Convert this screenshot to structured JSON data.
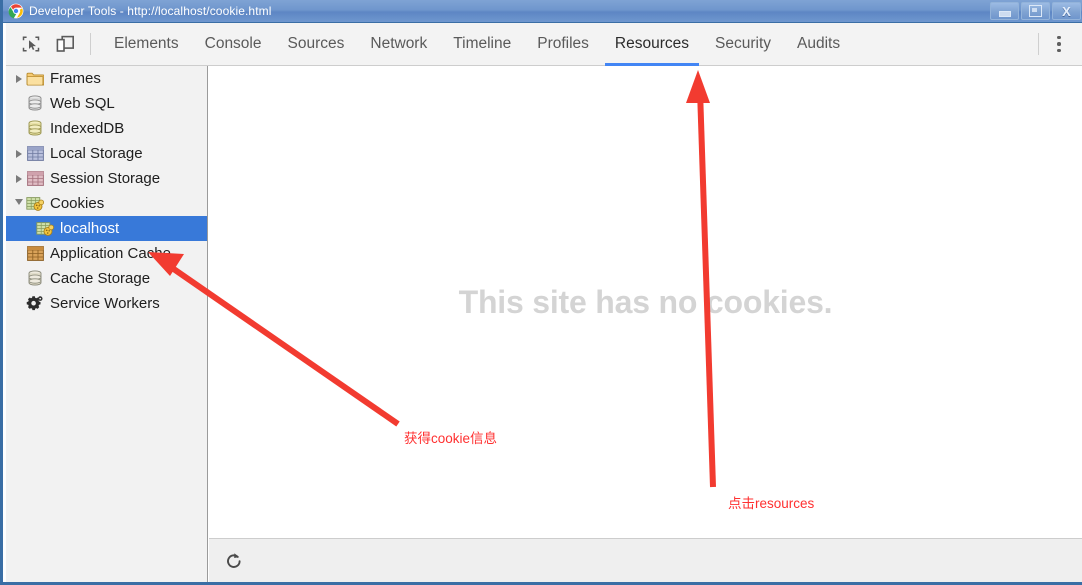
{
  "window": {
    "title": "Developer Tools - http://localhost/cookie.html",
    "app_icon": "chrome-logo-icon",
    "controls": [
      {
        "name": "minimize-button",
        "glyph": "minimize-icon"
      },
      {
        "name": "maximize-button",
        "glyph": "restore-icon"
      },
      {
        "name": "close-button",
        "glyph": "close-icon",
        "label": "X"
      }
    ]
  },
  "toolbar": {
    "inspect_icon": "inspect-element-icon",
    "device_icon": "device-toolbar-icon",
    "menu_icon": "more-vertical-icon",
    "tabs": [
      {
        "label": "Elements",
        "active": false
      },
      {
        "label": "Console",
        "active": false
      },
      {
        "label": "Sources",
        "active": false
      },
      {
        "label": "Network",
        "active": false
      },
      {
        "label": "Timeline",
        "active": false
      },
      {
        "label": "Profiles",
        "active": false
      },
      {
        "label": "Resources",
        "active": true
      },
      {
        "label": "Security",
        "active": false
      },
      {
        "label": "Audits",
        "active": false
      }
    ],
    "active_tab": "Resources",
    "accent_color": "#4285f4"
  },
  "sidebar": {
    "items": [
      {
        "label": "Frames",
        "icon": "folder-icon",
        "twisty": "collapsed",
        "indent": 0,
        "selected": false
      },
      {
        "label": "Web SQL",
        "icon": "database-gray-icon",
        "twisty": "none",
        "indent": 1,
        "selected": false
      },
      {
        "label": "IndexedDB",
        "icon": "database-yellow-icon",
        "twisty": "none",
        "indent": 1,
        "selected": false
      },
      {
        "label": "Local Storage",
        "icon": "table-blue-icon",
        "twisty": "collapsed",
        "indent": 0,
        "selected": false
      },
      {
        "label": "Session Storage",
        "icon": "table-pink-icon",
        "twisty": "collapsed",
        "indent": 0,
        "selected": false
      },
      {
        "label": "Cookies",
        "icon": "cookies-folder-icon",
        "twisty": "expanded",
        "indent": 0,
        "selected": false
      },
      {
        "label": "localhost",
        "icon": "cookies-folder-icon",
        "twisty": "none",
        "indent": 2,
        "selected": true
      },
      {
        "label": "Application Cache",
        "icon": "table-orange-icon",
        "twisty": "none",
        "indent": 1,
        "selected": false
      },
      {
        "label": "Cache Storage",
        "icon": "database-gray-icon",
        "twisty": "none",
        "indent": 1,
        "selected": false
      },
      {
        "label": "Service Workers",
        "icon": "gear-icon",
        "twisty": "none",
        "indent": 1,
        "selected": false
      }
    ],
    "selection_color": "#3879d9"
  },
  "content": {
    "empty_message": "This site has no cookies.",
    "refresh_icon": "refresh-icon"
  },
  "annotations": {
    "color": "#ff3030",
    "items": [
      {
        "text": "获得cookie信息",
        "target": "localhost",
        "arrow": "diagonal-up-left"
      },
      {
        "text": "点击resources",
        "target": "Resources",
        "arrow": "vertical-up"
      }
    ]
  }
}
